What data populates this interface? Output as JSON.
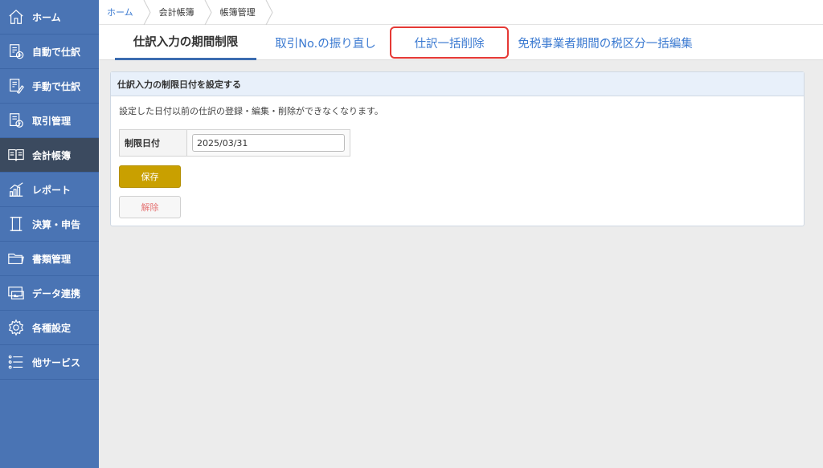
{
  "sidebar": {
    "items": [
      {
        "label": "ホーム",
        "icon": "home-icon"
      },
      {
        "label": "自動で仕訳",
        "icon": "auto-journal-icon"
      },
      {
        "label": "手動で仕訳",
        "icon": "manual-journal-icon"
      },
      {
        "label": "取引管理",
        "icon": "transaction-icon"
      },
      {
        "label": "会計帳簿",
        "icon": "book-icon"
      },
      {
        "label": "レポート",
        "icon": "report-chart-icon"
      },
      {
        "label": "決算・申告",
        "icon": "document-icon"
      },
      {
        "label": "書類管理",
        "icon": "folder-icon"
      },
      {
        "label": "データ連携",
        "icon": "data-link-icon"
      },
      {
        "label": "各種設定",
        "icon": "gear-icon"
      },
      {
        "label": "他サービス",
        "icon": "list-icon"
      }
    ],
    "active_index": 4,
    "color": "#4a74b4",
    "active_color": "#3b4a5f"
  },
  "breadcrumb": {
    "items": [
      "ホーム",
      "会計帳簿",
      "帳簿管理"
    ]
  },
  "tabs": {
    "items": [
      {
        "label": "仕訳入力の期間制限",
        "state": "active"
      },
      {
        "label": "取引No.の振り直し",
        "state": "inactive"
      },
      {
        "label": "仕訳一括削除",
        "state": "highlighted"
      },
      {
        "label": "免税事業者期間の税区分一括編集",
        "state": "inactive"
      }
    ]
  },
  "panel": {
    "title": "仕訳入力の制限日付を設定する",
    "description": "設定した日付以前の仕訳の登録・編集・削除ができなくなります。",
    "field_label": "制限日付",
    "field_value": "2025/03/31",
    "save_label": "保存",
    "release_label": "解除"
  },
  "colors": {
    "accent": "#3b7ad1",
    "save_button": "#c9a000",
    "highlight_border": "#e53935"
  }
}
